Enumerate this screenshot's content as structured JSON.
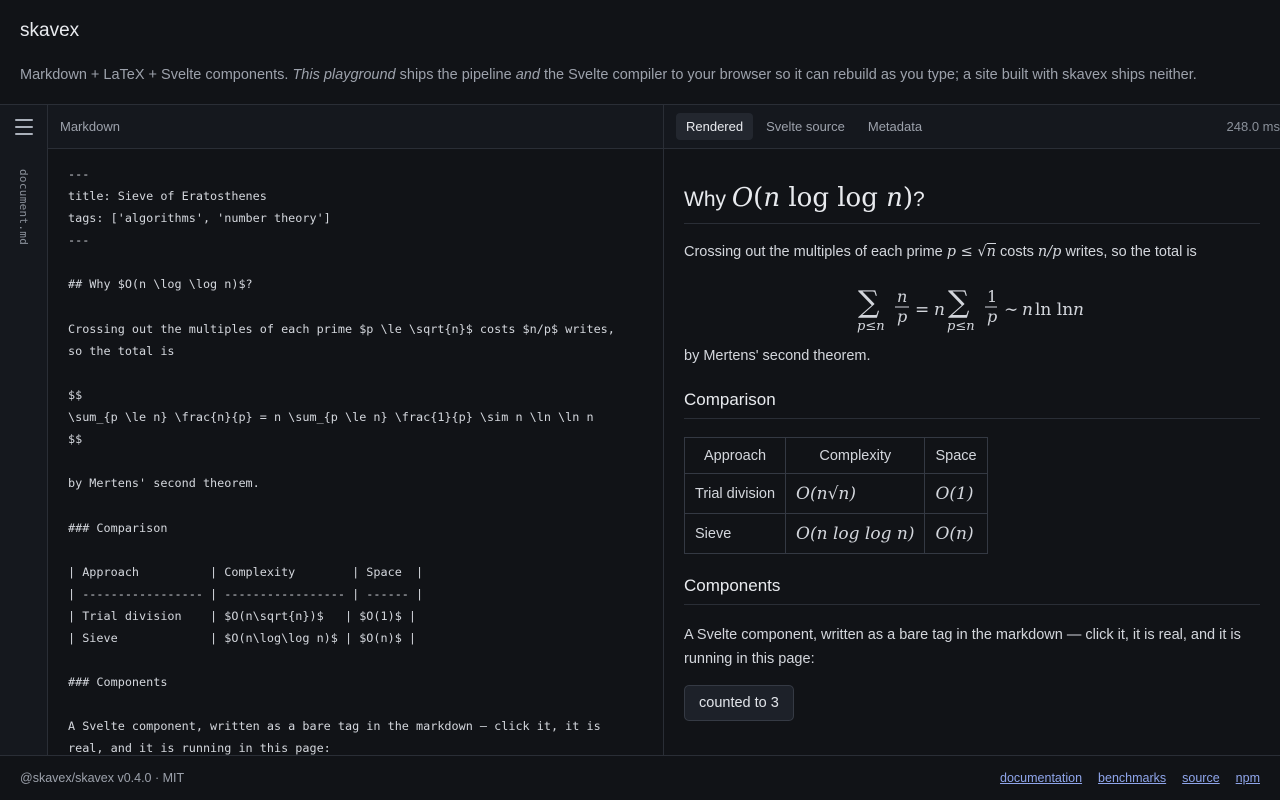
{
  "header": {
    "brand": "skavex",
    "tagline_1": "Markdown + LaTeX + Svelte components. ",
    "tagline_em1": "This playground",
    "tagline_2": " ships the pipeline ",
    "tagline_em2": "and",
    "tagline_3": " the Svelte compiler to your browser so it can rebuild as you type; a site built with skavex ships neither."
  },
  "rail": {
    "file": "document.md",
    "menu_icon": "hamburger-menu-icon"
  },
  "editor": {
    "label": "Markdown",
    "lines": [
      "---",
      "title: Sieve of Eratosthenes",
      "tags: ['algorithms', 'number theory']",
      "---",
      "",
      "## Why $O(n \\log \\log n)$?",
      "",
      "Crossing out the multiples of each prime $p \\le \\sqrt{n}$ costs $n/p$ writes,",
      "so the total is",
      "",
      "$$",
      "\\sum_{p \\le n} \\frac{n}{p} = n \\sum_{p \\le n} \\frac{1}{p} \\sim n \\ln \\ln n",
      "$$",
      "",
      "by Mertens' second theorem.",
      "",
      "### Comparison",
      "",
      "| Approach          | Complexity        | Space  |",
      "| ----------------- | ----------------- | ------ |",
      "| Trial division    | $O(n\\sqrt{n})$   | $O(1)$ |",
      "| Sieve             | $O(n\\log\\log n)$ | $O(n)$ |",
      "",
      "### Components",
      "",
      "A Svelte component, written as a bare tag in the markdown — click it, it is",
      "real, and it is running in this page:"
    ]
  },
  "preview": {
    "tabs": [
      "Rendered",
      "Svelte source",
      "Metadata"
    ],
    "timing": "248.0 ms",
    "heading_prefix": "Why ",
    "heading_math": "O(n log log n)",
    "heading_suffix": "?",
    "para1_a": "Crossing out the multiples of each prime ",
    "para1_math1": "p ≤ √n",
    "para1_b": " costs ",
    "para1_math2": "n/p",
    "para1_c": " writes, so the total is",
    "display_math": "∑ n/p = n ∑ 1/p ∼ n ln ln n",
    "para2": "by Mertens' second theorem.",
    "h3_comparison": "Comparison",
    "table": {
      "headers": [
        "Approach",
        "Complexity",
        "Space"
      ],
      "rows": [
        [
          "Trial division",
          "O(n√n)",
          "O(1)"
        ],
        [
          "Sieve",
          "O(n log log n)",
          "O(n)"
        ]
      ]
    },
    "h3_components": "Components",
    "para3": "A Svelte component, written as a bare tag in the markdown — click it, it is real, and it is running in this page:",
    "counter_label": "counted to 3"
  },
  "footer": {
    "package": "@skavex/skavex v0.4.0 · MIT",
    "links": [
      "documentation",
      "benchmarks",
      "source",
      "npm"
    ]
  }
}
